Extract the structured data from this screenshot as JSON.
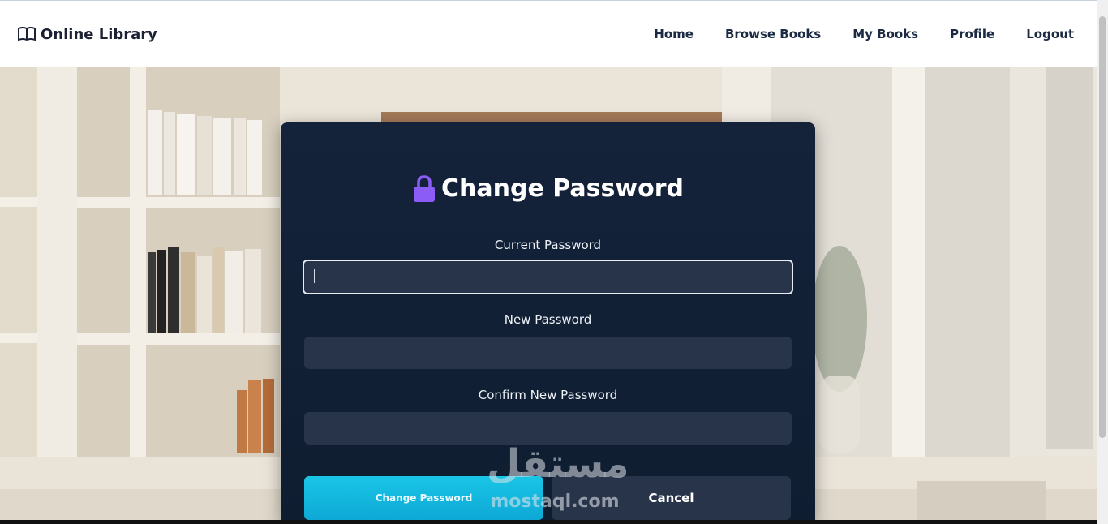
{
  "brand": {
    "name": "Online Library",
    "icon": "open-book-icon"
  },
  "nav": {
    "items": [
      "Home",
      "Browse Books",
      "My Books",
      "Profile",
      "Logout"
    ]
  },
  "modal": {
    "title": "Change Password",
    "title_icon": "lock-icon",
    "fields": [
      {
        "label": "Current Password",
        "value": "",
        "focused": true
      },
      {
        "label": "New Password",
        "value": ""
      },
      {
        "label": "Confirm New Password",
        "value": ""
      }
    ],
    "submit_label": "Change Password",
    "cancel_label": "Cancel"
  },
  "watermark": {
    "arabic": "مستقل",
    "latin": "mostaql.com"
  },
  "colors": {
    "accent": "#14c1e3",
    "card_bg": "#14233a",
    "input_bg": "#273449",
    "lock": "#8b5cf6"
  }
}
